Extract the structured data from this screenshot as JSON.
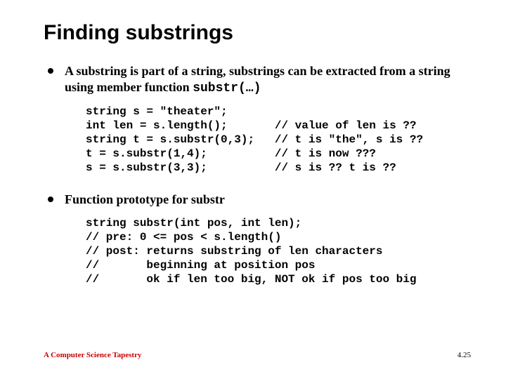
{
  "title": "Finding substrings",
  "bullets": [
    {
      "text_prefix": "A substring is part of a string, substrings can be extracted from a string using member function ",
      "code": "substr(…)"
    },
    {
      "text_prefix": "Function prototype for substr",
      "code": ""
    }
  ],
  "code_blocks": [
    "string s = \"theater\";\nint len = s.length();       // value of len is ??\nstring t = s.substr(0,3);   // t is \"the\", s is ??\nt = s.substr(1,4);          // t is now ???\ns = s.substr(3,3);          // s is ?? t is ??",
    "string substr(int pos, int len);\n// pre: 0 <= pos < s.length()\n// post: returns substring of len characters\n//       beginning at position pos\n//       ok if len too big, NOT ok if pos too big"
  ],
  "footer": {
    "left": "A Computer Science Tapestry",
    "right": "4.25"
  }
}
